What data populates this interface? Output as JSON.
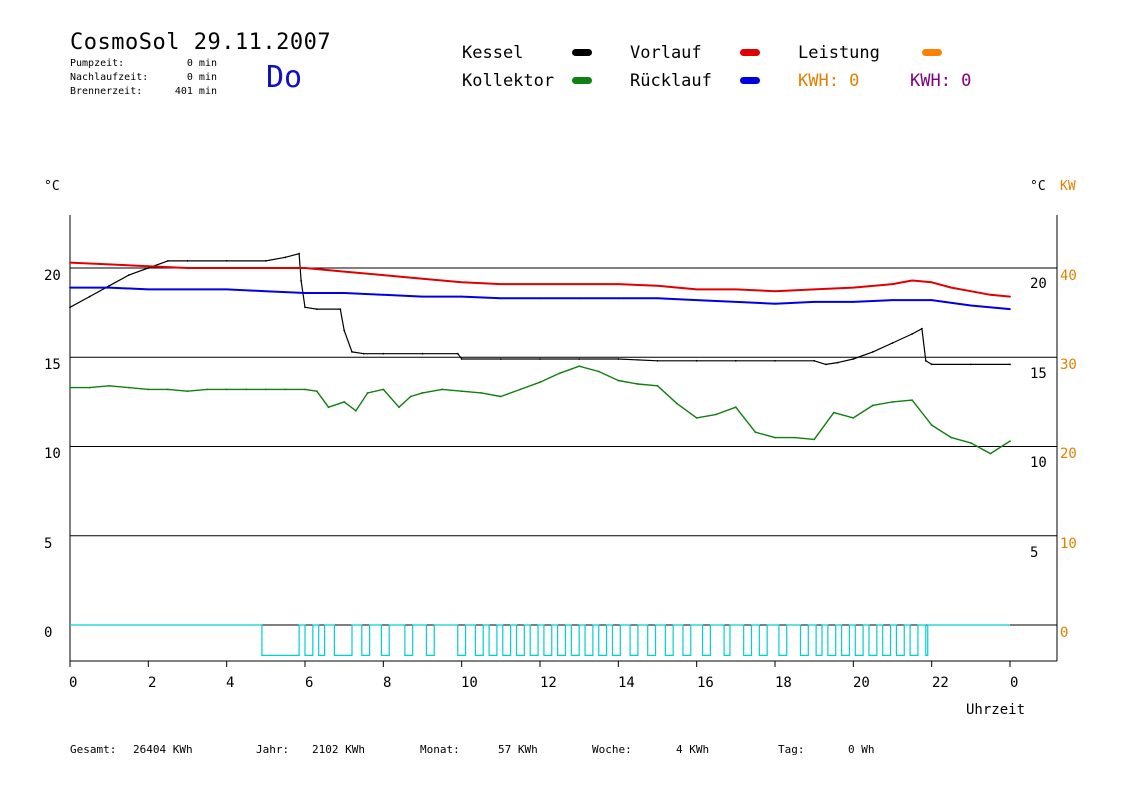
{
  "header": {
    "title": "CosmoSol 29.11.2007",
    "day": "Do",
    "stats": [
      {
        "label": "Pumpzeit:",
        "value": "0 min"
      },
      {
        "label": "Nachlaufzeit:",
        "value": "0 min"
      },
      {
        "label": "Brennerzeit:",
        "value": "401 min"
      }
    ]
  },
  "legend": {
    "items": [
      {
        "label": "Kessel",
        "color": "#000000"
      },
      {
        "label": "Vorlauf",
        "color": "#e00000"
      },
      {
        "label": "Leistung",
        "color": "#ff8000"
      },
      {
        "label": "Kollektor",
        "color": "#108010"
      },
      {
        "label": "Rücklauf",
        "color": "#0000e0"
      }
    ],
    "kwh": [
      {
        "text": "KWH: 0",
        "color": "#e08000"
      },
      {
        "text": "KWH: 0",
        "color": "#800080"
      }
    ]
  },
  "axes": {
    "left_unit": "°C",
    "right_unit": "°C",
    "right_unit2": "KW",
    "x_label": "Uhrzeit",
    "left_ticks": [
      "20",
      "15",
      "10",
      "5",
      "0"
    ],
    "right_ticks": [
      "20",
      "15",
      "10",
      "5"
    ],
    "right_kw_ticks": [
      "40",
      "30",
      "20",
      "10",
      "0"
    ],
    "x_ticks": [
      "0",
      "2",
      "4",
      "6",
      "8",
      "10",
      "12",
      "14",
      "16",
      "18",
      "20",
      "22",
      "0"
    ]
  },
  "footer": [
    {
      "label": "Gesamt:",
      "value": "26404 KWh"
    },
    {
      "label": "Jahr:",
      "value": "2102 KWh"
    },
    {
      "label": "Monat:",
      "value": "57 KWh"
    },
    {
      "label": "Woche:",
      "value": "4 KWh"
    },
    {
      "label": "Tag:",
      "value": "0 Wh"
    }
  ],
  "chart_data": {
    "type": "line",
    "xlabel": "Uhrzeit",
    "ylabel": "°C",
    "xlim": [
      0,
      24
    ],
    "ylim": [
      -2,
      23
    ],
    "grid": true,
    "series": [
      {
        "name": "Kessel",
        "color": "#000000",
        "x": [
          0,
          0.5,
          1,
          1.5,
          2,
          2.5,
          3,
          4,
          5,
          5.5,
          5.85,
          5.9,
          6,
          6.3,
          6.9,
          7,
          7.2,
          7.5,
          8,
          9,
          9.9,
          10,
          11,
          12,
          13,
          14,
          15,
          16,
          17,
          18,
          19,
          19.3,
          19.6,
          20,
          20.5,
          21,
          21.5,
          21.75,
          21.85,
          22,
          23,
          24
        ],
        "values": [
          17.8,
          18.4,
          19.0,
          19.6,
          20.0,
          20.4,
          20.4,
          20.4,
          20.4,
          20.6,
          20.8,
          19.3,
          17.8,
          17.7,
          17.7,
          16.5,
          15.3,
          15.2,
          15.2,
          15.2,
          15.2,
          14.9,
          14.9,
          14.9,
          14.9,
          14.9,
          14.8,
          14.8,
          14.8,
          14.8,
          14.8,
          14.6,
          14.7,
          14.9,
          15.3,
          15.8,
          16.3,
          16.6,
          14.8,
          14.6,
          14.6,
          14.6
        ]
      },
      {
        "name": "Vorlauf",
        "color": "#e00000",
        "x": [
          0,
          1,
          2,
          3,
          4,
          5,
          6,
          7,
          8,
          9,
          10,
          11,
          12,
          13,
          14,
          15,
          16,
          17,
          18,
          19,
          20,
          21,
          21.5,
          22,
          22.5,
          23,
          23.5,
          24
        ],
        "values": [
          20.3,
          20.2,
          20.1,
          20.0,
          20.0,
          20.0,
          20.0,
          19.8,
          19.6,
          19.4,
          19.2,
          19.1,
          19.1,
          19.1,
          19.1,
          19.0,
          18.8,
          18.8,
          18.7,
          18.8,
          18.9,
          19.1,
          19.3,
          19.2,
          18.9,
          18.7,
          18.5,
          18.4
        ]
      },
      {
        "name": "Rücklauf",
        "color": "#0000e0",
        "x": [
          0,
          1,
          2,
          3,
          4,
          5,
          6,
          7,
          8,
          9,
          10,
          11,
          12,
          13,
          14,
          15,
          16,
          17,
          18,
          19,
          20,
          21,
          22,
          23,
          24
        ],
        "values": [
          18.9,
          18.9,
          18.8,
          18.8,
          18.8,
          18.7,
          18.6,
          18.6,
          18.5,
          18.4,
          18.4,
          18.3,
          18.3,
          18.3,
          18.3,
          18.3,
          18.2,
          18.1,
          18.0,
          18.1,
          18.1,
          18.2,
          18.2,
          17.9,
          17.7
        ]
      },
      {
        "name": "Kollektor",
        "color": "#108010",
        "x": [
          0,
          0.5,
          1,
          1.5,
          2,
          2.5,
          3,
          3.5,
          4,
          4.5,
          5,
          5.5,
          6,
          6.3,
          6.6,
          7,
          7.3,
          7.6,
          8,
          8.4,
          8.7,
          9,
          9.5,
          10,
          10.5,
          11,
          11.5,
          12,
          12.5,
          13,
          13.5,
          14,
          14.5,
          15,
          15.5,
          16,
          16.5,
          17,
          17.5,
          18,
          18.5,
          19,
          19.5,
          20,
          20.5,
          21,
          21.5,
          22,
          22.5,
          23,
          23.5,
          24
        ],
        "values": [
          13.3,
          13.3,
          13.4,
          13.3,
          13.2,
          13.2,
          13.1,
          13.2,
          13.2,
          13.2,
          13.2,
          13.2,
          13.2,
          13.1,
          12.2,
          12.5,
          12.0,
          13.0,
          13.2,
          12.2,
          12.8,
          13.0,
          13.2,
          13.1,
          13.0,
          12.8,
          13.2,
          13.6,
          14.1,
          14.5,
          14.2,
          13.7,
          13.5,
          13.4,
          12.4,
          11.6,
          11.8,
          12.2,
          10.8,
          10.5,
          10.5,
          10.4,
          11.9,
          11.6,
          12.3,
          12.5,
          12.6,
          11.2,
          10.5,
          10.2,
          9.6,
          10.3
        ]
      }
    ],
    "pump_signal": {
      "color": "#00d0d0",
      "baseline": 0,
      "pulse_starts": [
        4.9,
        6.0,
        6.35,
        6.75,
        7.45,
        7.95,
        8.55,
        9.1,
        9.9,
        10.35,
        10.7,
        11.05,
        11.4,
        11.75,
        12.1,
        12.45,
        12.8,
        13.15,
        13.5,
        13.85,
        14.3,
        14.75,
        15.2,
        15.65,
        16.15,
        16.7,
        17.2,
        17.6,
        18.1,
        18.65,
        19.05,
        19.35,
        19.7,
        20.05,
        20.4,
        20.75,
        21.1,
        21.45,
        21.85
      ],
      "pulse_ends": [
        5.85,
        6.2,
        6.5,
        7.2,
        7.65,
        8.15,
        8.75,
        9.3,
        10.1,
        10.55,
        10.9,
        11.25,
        11.6,
        11.95,
        12.3,
        12.65,
        13.0,
        13.35,
        13.7,
        14.05,
        14.5,
        14.95,
        15.4,
        15.85,
        16.35,
        16.85,
        17.4,
        17.8,
        18.3,
        18.85,
        19.2,
        19.55,
        19.9,
        20.25,
        20.6,
        20.95,
        21.3,
        21.65,
        21.9
      ],
      "pulse_depth": -1.7
    }
  }
}
